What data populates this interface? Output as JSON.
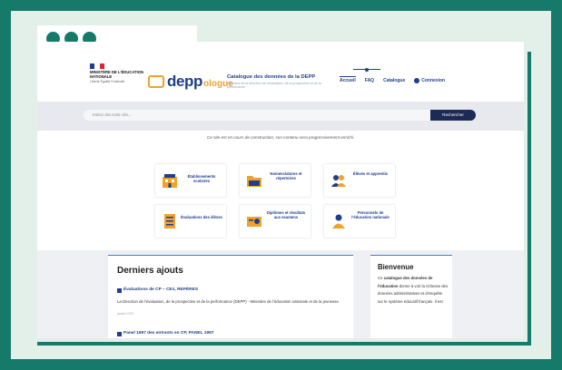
{
  "window": {
    "dot_color": "#167a6a"
  },
  "header": {
    "ministry": "MINISTÈRE DE L'ÉDUCATION NATIONALE",
    "ministry_motto": "Liberté Égalité Fraternité",
    "logo_depp": "depp",
    "logo_ologue": "ologue",
    "site_title": "Catalogue des données de la DEPP",
    "site_tagline": "Données de la direction de l'évaluation, de la prospective et de la performance",
    "nav": [
      {
        "label": "Accueil"
      },
      {
        "label": "FAQ"
      },
      {
        "label": "Catalogue"
      },
      {
        "label": "Connexion"
      }
    ]
  },
  "search": {
    "placeholder": "Entrez des mots-clés...",
    "button_label": "Rechercher"
  },
  "notice": "Ce site est en cours de construction, son contenu sera progressivement enrichi.",
  "categories": [
    {
      "label": "Établissements scolaires"
    },
    {
      "label": "Nomenclatures et répertoires"
    },
    {
      "label": "Élèves et apprentis"
    },
    {
      "label": "Évaluations des élèves"
    },
    {
      "label": "Diplômes et résultats aux examens"
    },
    {
      "label": "Personnels de l'éducation nationale"
    }
  ],
  "latest": {
    "title": "Derniers ajouts",
    "items": [
      {
        "title": "Évaluations de CP – CE1, REPÈRES",
        "description": "La Direction de l'évaluation, de la prospective et de la performance (DEPP) - Ministère de l'éducation nationale et de la jeunesse",
        "meta": "janvier 2021"
      },
      {
        "title": "Panel 1997 des entrants en CP, PANEL 1997"
      }
    ]
  },
  "welcome": {
    "title": "Bienvenue",
    "text_1": "Ce ",
    "text_bold": "catalogue des données de l'éducation",
    "text_2": " donne à voir la richesse des données administratives et d'enquête sur le système éducatif français. Il est"
  }
}
